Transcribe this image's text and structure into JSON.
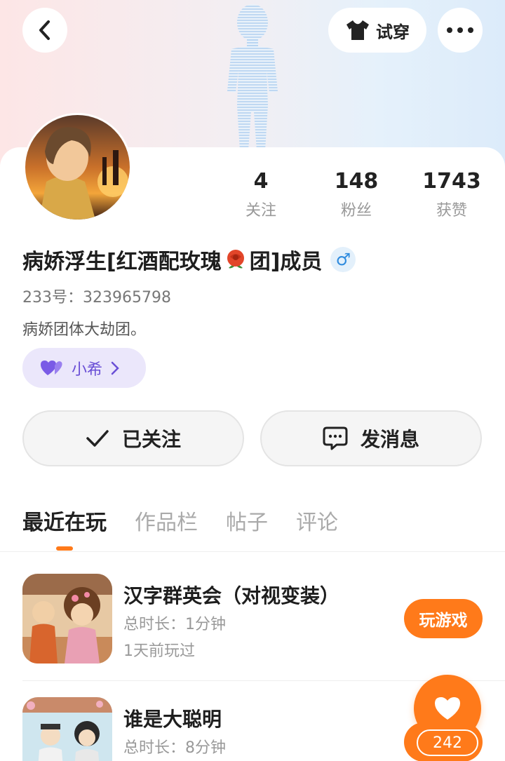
{
  "header": {
    "tryon_label": "试穿",
    "back_icon": "chevron-left-icon",
    "more_icon": "more-horizontal-icon",
    "tryon_icon": "tshirt-icon"
  },
  "profile": {
    "stats": [
      {
        "value": "4",
        "label": "关注"
      },
      {
        "value": "148",
        "label": "粉丝"
      },
      {
        "value": "1743",
        "label": "获赞"
      }
    ],
    "name_prefix": "病娇浮生[红酒配玫瑰",
    "name_suffix": "团]成员",
    "gender_symbol": "♂",
    "uid": "233号：323965798",
    "bio": "病娇团体大劫团。",
    "cp_name": "小希"
  },
  "actions": {
    "follow_label": "已关注",
    "message_label": "发消息"
  },
  "tabs": [
    {
      "label": "最近在玩",
      "active": true
    },
    {
      "label": "作品栏",
      "active": false
    },
    {
      "label": "帖子",
      "active": false
    },
    {
      "label": "评论",
      "active": false
    }
  ],
  "games": [
    {
      "title": "汉字群英会（对视变装）",
      "duration": "总时长：1分钟",
      "last_played": "1天前玩过",
      "button": "玩游戏"
    },
    {
      "title": "谁是大聪明",
      "duration": "总时长：8分钟"
    }
  ],
  "like": {
    "count": "242"
  },
  "colors": {
    "accent": "#ff7a1a",
    "cp_purple": "#6a4fd6"
  }
}
